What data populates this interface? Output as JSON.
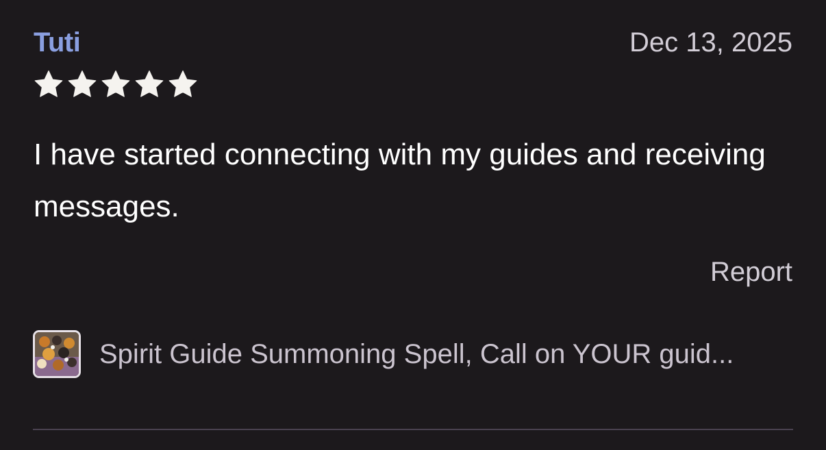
{
  "review": {
    "reviewer_name": "Tuti",
    "date": "Dec 13, 2025",
    "rating": 5,
    "rating_max": 5,
    "body": "I have started connecting with my guides and receiving messages.",
    "report_label": "Report"
  },
  "product": {
    "title": "Spirit Guide Summoning Spell, Call on YOUR guid...",
    "thumbnail_icon": "product-thumbnail"
  },
  "colors": {
    "background": "#1c191c",
    "reviewer_name": "#8a9fe0",
    "secondary_text": "#d2cdd6",
    "stars": "#f5f3ef"
  }
}
